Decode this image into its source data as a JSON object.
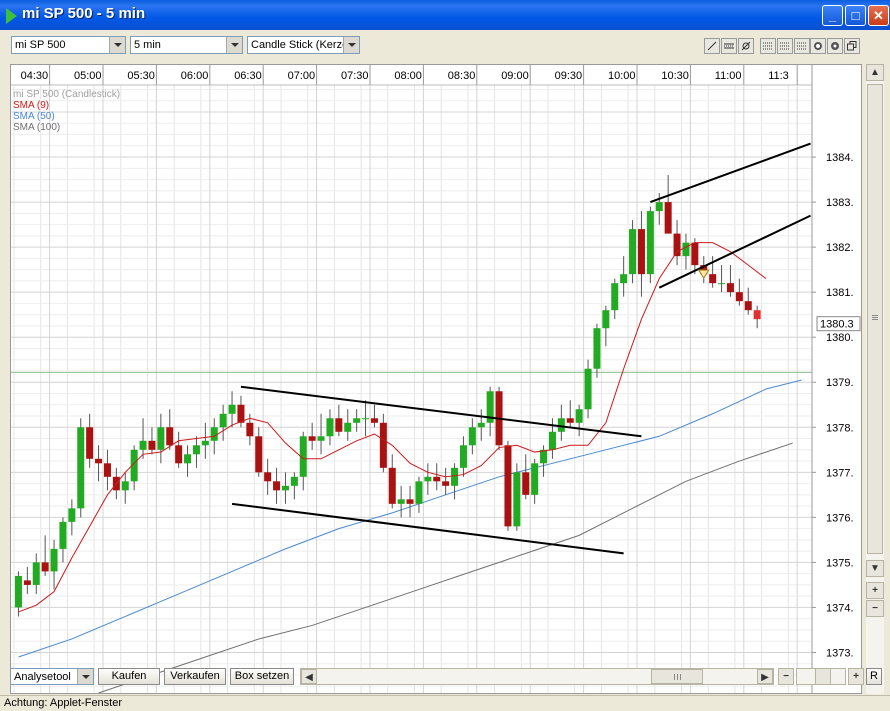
{
  "window": {
    "title": "mi SP 500 - 5 min",
    "minimize_label": "_",
    "maximize_label": "□",
    "close_label": "✕"
  },
  "toolbar": {
    "instrument": "mi SP 500",
    "interval": "5 min",
    "chart_style": "Candle Stick (Kerze"
  },
  "bottom": {
    "analysis_tool": "Analysetool",
    "buy": "Kaufen",
    "sell": "Verkaufen",
    "box": "Box setzen",
    "reset": "R"
  },
  "status": {
    "text": "Achtung: Applet-Fenster"
  },
  "colors": {
    "up": "#22AA22",
    "down": "#AA1111",
    "sma9": "#D01818",
    "sma50": "#4A88D0",
    "sma100": "#707070",
    "last_candle": "#E03030"
  },
  "chart_data": {
    "type": "candlestick",
    "legend": [
      {
        "label": "mi SP 500 (Candlestick)",
        "color": "#A0A0A0"
      },
      {
        "label": "SMA (9)",
        "color": "#D01818"
      },
      {
        "label": "SMA (50)",
        "color": "#4A88D0"
      },
      {
        "label": "SMA (100)",
        "color": "#707070"
      }
    ],
    "x_tick_labels": [
      "04:30",
      "05:00",
      "05:30",
      "06:00",
      "06:30",
      "07:00",
      "07:30",
      "08:00",
      "08:30",
      "09:00",
      "09:30",
      "10:00",
      "10:30",
      "11:00",
      "11:3"
    ],
    "x_tick_slots": [
      4,
      10,
      16,
      22,
      28,
      34,
      40,
      46,
      52,
      58,
      64,
      70,
      76,
      82,
      88
    ],
    "y_ticks": [
      1373,
      1374,
      1375,
      1376,
      1377,
      1378,
      1379,
      1380,
      1381,
      1382,
      1383,
      1384
    ],
    "y_tick_labels": [
      "1373.",
      "1374.",
      "1375.",
      "1376.",
      "1377.",
      "1378.",
      "1379.",
      "1380.",
      "1381.",
      "1382.",
      "1383.",
      "1384."
    ],
    "ylim": [
      1372.1,
      1385.6
    ],
    "last_price_label": "1380.3",
    "last_price": 1380.3,
    "candles": [
      [
        1374,
        1374.8,
        1373.8,
        1374.7
      ],
      [
        1374.6,
        1374.9,
        1374.3,
        1374.5
      ],
      [
        1374.5,
        1375.2,
        1374.3,
        1375
      ],
      [
        1375,
        1375.6,
        1374.7,
        1374.8
      ],
      [
        1374.8,
        1375.5,
        1374.4,
        1375.3
      ],
      [
        1375.3,
        1376,
        1375,
        1375.9
      ],
      [
        1375.9,
        1376.4,
        1375.6,
        1376.2
      ],
      [
        1376.2,
        1378.2,
        1376,
        1378
      ],
      [
        1378,
        1378.3,
        1377.1,
        1377.3
      ],
      [
        1377.3,
        1377.6,
        1376.8,
        1377.2
      ],
      [
        1377.2,
        1377.5,
        1376.6,
        1376.9
      ],
      [
        1376.9,
        1377.1,
        1376.4,
        1376.6
      ],
      [
        1376.6,
        1377,
        1376.3,
        1376.8
      ],
      [
        1376.8,
        1377.6,
        1376.6,
        1377.5
      ],
      [
        1377.5,
        1378.2,
        1377.3,
        1377.7
      ],
      [
        1377.7,
        1378,
        1377.4,
        1377.5
      ],
      [
        1377.5,
        1378.3,
        1377.2,
        1378
      ],
      [
        1378,
        1378.4,
        1377.5,
        1377.6
      ],
      [
        1377.6,
        1377.9,
        1377.1,
        1377.2
      ],
      [
        1377.2,
        1377.6,
        1376.9,
        1377.4
      ],
      [
        1377.4,
        1377.8,
        1377.1,
        1377.6
      ],
      [
        1377.6,
        1378.1,
        1377.3,
        1377.7
      ],
      [
        1377.7,
        1378.2,
        1377.4,
        1378
      ],
      [
        1378,
        1378.5,
        1377.7,
        1378.3
      ],
      [
        1378.3,
        1378.8,
        1378,
        1378.5
      ],
      [
        1378.5,
        1378.7,
        1378,
        1378.1
      ],
      [
        1378.1,
        1378.3,
        1377.6,
        1377.8
      ],
      [
        1377.8,
        1378,
        1376.9,
        1377
      ],
      [
        1377,
        1377.3,
        1376.5,
        1376.8
      ],
      [
        1376.8,
        1377.1,
        1376.3,
        1376.6
      ],
      [
        1376.6,
        1377,
        1376.3,
        1376.7
      ],
      [
        1376.7,
        1377,
        1376.4,
        1376.9
      ],
      [
        1376.9,
        1377.9,
        1376.6,
        1377.8
      ],
      [
        1377.8,
        1378.1,
        1377.5,
        1377.7
      ],
      [
        1377.7,
        1378.3,
        1377.4,
        1377.8
      ],
      [
        1377.8,
        1378.4,
        1377.6,
        1378.2
      ],
      [
        1378.2,
        1378.5,
        1377.8,
        1377.9
      ],
      [
        1377.9,
        1378.4,
        1377.7,
        1378.1
      ],
      [
        1378.1,
        1378.4,
        1377.9,
        1378.2
      ],
      [
        1378.2,
        1378.6,
        1377.8,
        1378.2
      ],
      [
        1378.2,
        1378.5,
        1378,
        1378.1
      ],
      [
        1378.1,
        1378.3,
        1377,
        1377.1
      ],
      [
        1377.1,
        1377.4,
        1376.2,
        1376.3
      ],
      [
        1376.3,
        1376.7,
        1376,
        1376.4
      ],
      [
        1376.4,
        1376.7,
        1376,
        1376.3
      ],
      [
        1376.3,
        1376.9,
        1376.1,
        1376.8
      ],
      [
        1376.8,
        1377.2,
        1376.5,
        1376.9
      ],
      [
        1376.9,
        1377.2,
        1376.6,
        1376.8
      ],
      [
        1376.8,
        1377.1,
        1376.5,
        1376.7
      ],
      [
        1376.7,
        1377.2,
        1376.4,
        1377.1
      ],
      [
        1377.1,
        1377.8,
        1376.9,
        1377.6
      ],
      [
        1377.6,
        1378.2,
        1377.4,
        1378
      ],
      [
        1378,
        1378.4,
        1377.7,
        1378.1
      ],
      [
        1378.1,
        1378.9,
        1377.8,
        1378.8
      ],
      [
        1378.8,
        1378.9,
        1377.5,
        1377.6
      ],
      [
        1377.6,
        1377.7,
        1375.7,
        1375.8
      ],
      [
        1375.8,
        1377.2,
        1375.7,
        1377
      ],
      [
        1377,
        1377.4,
        1376.4,
        1376.5
      ],
      [
        1376.5,
        1377.3,
        1376.3,
        1377.2
      ],
      [
        1377.2,
        1377.6,
        1376.9,
        1377.5
      ],
      [
        1377.5,
        1378.2,
        1377.3,
        1377.9
      ],
      [
        1377.9,
        1378.5,
        1377.7,
        1378.2
      ],
      [
        1378.2,
        1378.6,
        1378,
        1378.1
      ],
      [
        1378.1,
        1378.5,
        1377.8,
        1378.4
      ],
      [
        1378.4,
        1379.5,
        1378.2,
        1379.3
      ],
      [
        1379.3,
        1380.3,
        1379.1,
        1380.2
      ],
      [
        1380.2,
        1380.7,
        1379.8,
        1380.6
      ],
      [
        1380.6,
        1381.3,
        1380.4,
        1381.2
      ],
      [
        1381.2,
        1381.8,
        1380.9,
        1381.4
      ],
      [
        1381.4,
        1382.6,
        1381.2,
        1382.4
      ],
      [
        1382.4,
        1382.8,
        1380.9,
        1381.4
      ],
      [
        1381.4,
        1382.9,
        1381.2,
        1382.8
      ],
      [
        1382.8,
        1383.2,
        1382.5,
        1383
      ],
      [
        1383,
        1383.6,
        1382.7,
        1382.3
      ],
      [
        1382.3,
        1382.6,
        1381.6,
        1381.8
      ],
      [
        1381.8,
        1382.3,
        1381.5,
        1382.1
      ],
      [
        1382.1,
        1382.2,
        1381.4,
        1381.6
      ],
      [
        1381.6,
        1381.8,
        1381.2,
        1381.4
      ],
      [
        1381.4,
        1381.8,
        1381.1,
        1381.2
      ],
      [
        1381.2,
        1381.6,
        1381,
        1381.2
      ],
      [
        1381.2,
        1381.6,
        1380.9,
        1381.0
      ],
      [
        1381,
        1381.3,
        1380.7,
        1380.8
      ],
      [
        1380.8,
        1381.1,
        1380.5,
        1380.6
      ],
      [
        1380.6,
        1380.7,
        1380.2,
        1380.4
      ]
    ],
    "sma9": [
      [
        0,
        1373.9
      ],
      [
        2,
        1374.05
      ],
      [
        4,
        1374.35
      ],
      [
        6,
        1375.1
      ],
      [
        8,
        1375.8
      ],
      [
        10,
        1376.5
      ],
      [
        12,
        1377
      ],
      [
        14,
        1377.4
      ],
      [
        16,
        1377.45
      ],
      [
        18,
        1377.7
      ],
      [
        20,
        1377.75
      ],
      [
        22,
        1377.8
      ],
      [
        24,
        1378.05
      ],
      [
        26,
        1378.2
      ],
      [
        28,
        1378.1
      ],
      [
        30,
        1377.65
      ],
      [
        32,
        1377.3
      ],
      [
        34,
        1377.3
      ],
      [
        36,
        1377.5
      ],
      [
        38,
        1377.7
      ],
      [
        40,
        1377.85
      ],
      [
        42,
        1377.6
      ],
      [
        44,
        1377.2
      ],
      [
        46,
        1377.0
      ],
      [
        48,
        1376.9
      ],
      [
        50,
        1376.95
      ],
      [
        52,
        1377.15
      ],
      [
        54,
        1377.55
      ],
      [
        56,
        1377.6
      ],
      [
        58,
        1377.45
      ],
      [
        60,
        1377.5
      ],
      [
        62,
        1377.6
      ],
      [
        64,
        1377.6
      ],
      [
        66,
        1378.1
      ],
      [
        68,
        1379.3
      ],
      [
        70,
        1380.4
      ],
      [
        72,
        1381.3
      ],
      [
        74,
        1381.9
      ],
      [
        76,
        1382.1
      ],
      [
        78,
        1382.1
      ],
      [
        80,
        1381.9
      ],
      [
        82,
        1381.6
      ],
      [
        84,
        1381.3
      ]
    ],
    "sma50": [
      [
        0,
        1372.9
      ],
      [
        6,
        1373.3
      ],
      [
        12,
        1373.8
      ],
      [
        18,
        1374.3
      ],
      [
        24,
        1374.8
      ],
      [
        30,
        1375.3
      ],
      [
        36,
        1375.75
      ],
      [
        42,
        1376.1
      ],
      [
        48,
        1376.5
      ],
      [
        54,
        1376.9
      ],
      [
        60,
        1377.2
      ],
      [
        66,
        1377.5
      ],
      [
        72,
        1377.8
      ],
      [
        78,
        1378.3
      ],
      [
        84,
        1378.85
      ],
      [
        88,
        1379.05
      ]
    ],
    "sma100": [
      [
        9,
        1372.1
      ],
      [
        15,
        1372.5
      ],
      [
        21,
        1372.9
      ],
      [
        27,
        1373.3
      ],
      [
        33,
        1373.6
      ],
      [
        39,
        1374.0
      ],
      [
        45,
        1374.4
      ],
      [
        51,
        1374.8
      ],
      [
        57,
        1375.2
      ],
      [
        63,
        1375.6
      ],
      [
        69,
        1376.2
      ],
      [
        75,
        1376.8
      ],
      [
        81,
        1377.25
      ],
      [
        87,
        1377.65
      ]
    ],
    "trendlines": [
      [
        [
          25,
          1378.9
        ],
        [
          70,
          1377.8
        ]
      ],
      [
        [
          24,
          1376.3
        ],
        [
          68,
          1375.2
        ]
      ],
      [
        [
          71,
          1383.0
        ],
        [
          89,
          1384.3
        ]
      ],
      [
        [
          72,
          1381.1
        ],
        [
          89,
          1382.7
        ]
      ]
    ],
    "markers": [
      {
        "slot": 77,
        "price": 1381.4,
        "shape": "triangle-down"
      }
    ]
  }
}
